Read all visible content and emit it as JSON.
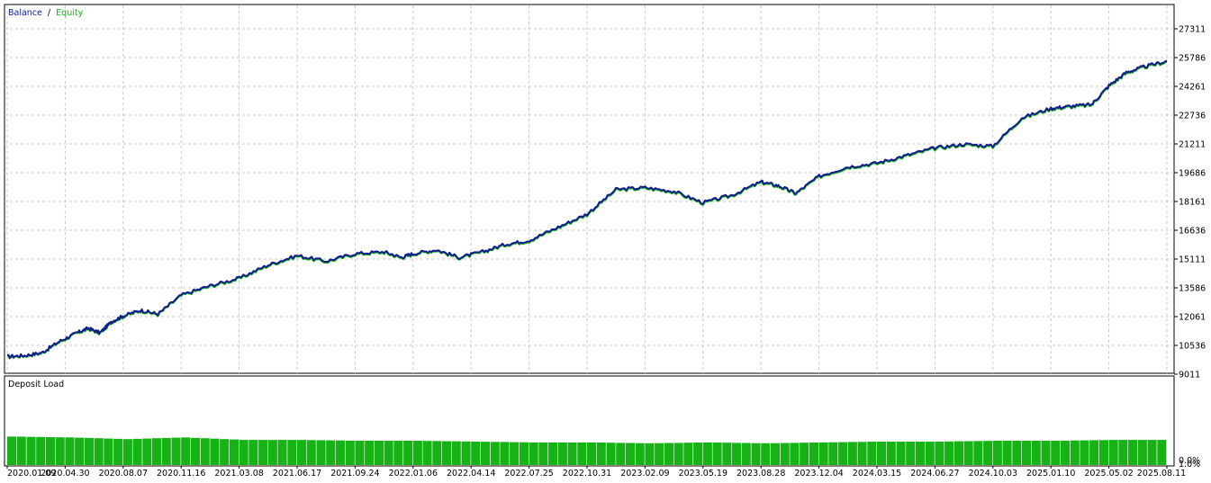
{
  "chart_data": [
    {
      "type": "line",
      "title": "",
      "legend": {
        "placement": "top-left",
        "balance_label": "Balance",
        "separator": "/",
        "equity_label": "Equity"
      },
      "ylim": [
        9011,
        27311
      ],
      "y_ticks": [
        "27311",
        "25786",
        "24261",
        "22736",
        "21211",
        "19686",
        "18161",
        "16636",
        "15111",
        "13586",
        "12061",
        "10536",
        "9011"
      ],
      "x_ticks": [
        "2020.01.09",
        "2020.04.30",
        "2020.08.07",
        "2020.11.16",
        "2021.03.08",
        "2021.06.17",
        "2021.09.24",
        "2022.01.06",
        "2022.04.14",
        "2022.07.25",
        "2022.10.31",
        "2023.02.09",
        "2023.05.19",
        "2023.08.28",
        "2023.12.04",
        "2024.03.15",
        "2024.06.27",
        "2024.10.03",
        "2025.01.10",
        "2025.05.02",
        "2025.08.11"
      ],
      "grid": true,
      "colors": {
        "balance": "#0f1e8c",
        "equity": "#16b216"
      },
      "series": [
        {
          "name": "Balance",
          "x": [
            0,
            0.3,
            0.6,
            0.9,
            1.2,
            1.4,
            1.6,
            1.8,
            2.0,
            2.3,
            2.6,
            3.0,
            3.5,
            4.0,
            4.5,
            5.0,
            5.5,
            6.0,
            6.5,
            6.8,
            7.0,
            7.4,
            7.8,
            8.2,
            8.6,
            9.0,
            9.5,
            10.0,
            10.5,
            11.0,
            11.5,
            12.0,
            12.5,
            13.0,
            13.3,
            13.6,
            14.0,
            14.5,
            15.0,
            15.5,
            16.0,
            16.5,
            17.0,
            17.5,
            18.0,
            18.3,
            18.7,
            19.0,
            19.3,
            19.6,
            20.0
          ],
          "values": [
            9950,
            10000,
            10150,
            10750,
            11200,
            11450,
            11200,
            11800,
            12100,
            12400,
            12200,
            13200,
            13700,
            14100,
            14800,
            15300,
            15000,
            15400,
            15500,
            15200,
            15400,
            15600,
            15200,
            15500,
            15900,
            16100,
            16800,
            17500,
            18800,
            18900,
            18700,
            18100,
            18500,
            19200,
            19000,
            18600,
            19500,
            20000,
            20200,
            20600,
            21000,
            21200,
            21100,
            22600,
            23100,
            23200,
            23300,
            24300,
            25000,
            25300,
            25600
          ]
        },
        {
          "name": "Equity",
          "x": [
            0,
            0.3,
            0.6,
            0.9,
            1.2,
            1.4,
            1.6,
            1.8,
            2.0,
            2.3,
            2.6,
            3.0,
            3.5,
            4.0,
            4.5,
            5.0,
            5.5,
            6.0,
            6.5,
            6.8,
            7.0,
            7.4,
            7.8,
            8.2,
            8.6,
            9.0,
            9.5,
            10.0,
            10.5,
            11.0,
            11.5,
            12.0,
            12.5,
            13.0,
            13.3,
            13.6,
            14.0,
            14.5,
            15.0,
            15.5,
            16.0,
            16.5,
            17.0,
            17.5,
            18.0,
            18.3,
            18.7,
            19.0,
            19.3,
            19.6,
            20.0
          ],
          "values": [
            9930,
            9980,
            10130,
            10720,
            11170,
            11420,
            11180,
            11770,
            12070,
            12370,
            12170,
            13170,
            13660,
            14060,
            14760,
            15260,
            14960,
            15360,
            15460,
            15170,
            15370,
            15570,
            15170,
            15470,
            15870,
            16060,
            16760,
            17460,
            18760,
            18860,
            18660,
            18060,
            18460,
            19160,
            18960,
            18560,
            19460,
            19960,
            20160,
            20560,
            20960,
            21160,
            21060,
            22560,
            23060,
            23160,
            23260,
            24260,
            24960,
            25260,
            25560
          ]
        }
      ]
    },
    {
      "type": "bar",
      "title": "Deposit Load",
      "ylim": [
        0.0,
        1.0
      ],
      "y_ticks": [
        "1.0%",
        "0.0%"
      ],
      "y_unit": "%",
      "x": [
        0,
        1,
        2,
        3,
        4,
        5,
        6,
        7,
        8,
        9,
        10,
        11,
        12,
        13,
        14,
        15,
        16,
        17,
        18,
        19,
        20
      ],
      "values": [
        0.34,
        0.33,
        0.31,
        0.33,
        0.3,
        0.3,
        0.29,
        0.29,
        0.28,
        0.27,
        0.27,
        0.26,
        0.27,
        0.26,
        0.27,
        0.28,
        0.28,
        0.29,
        0.29,
        0.3,
        0.3
      ],
      "colors": {
        "bar": "#16b216"
      }
    }
  ]
}
